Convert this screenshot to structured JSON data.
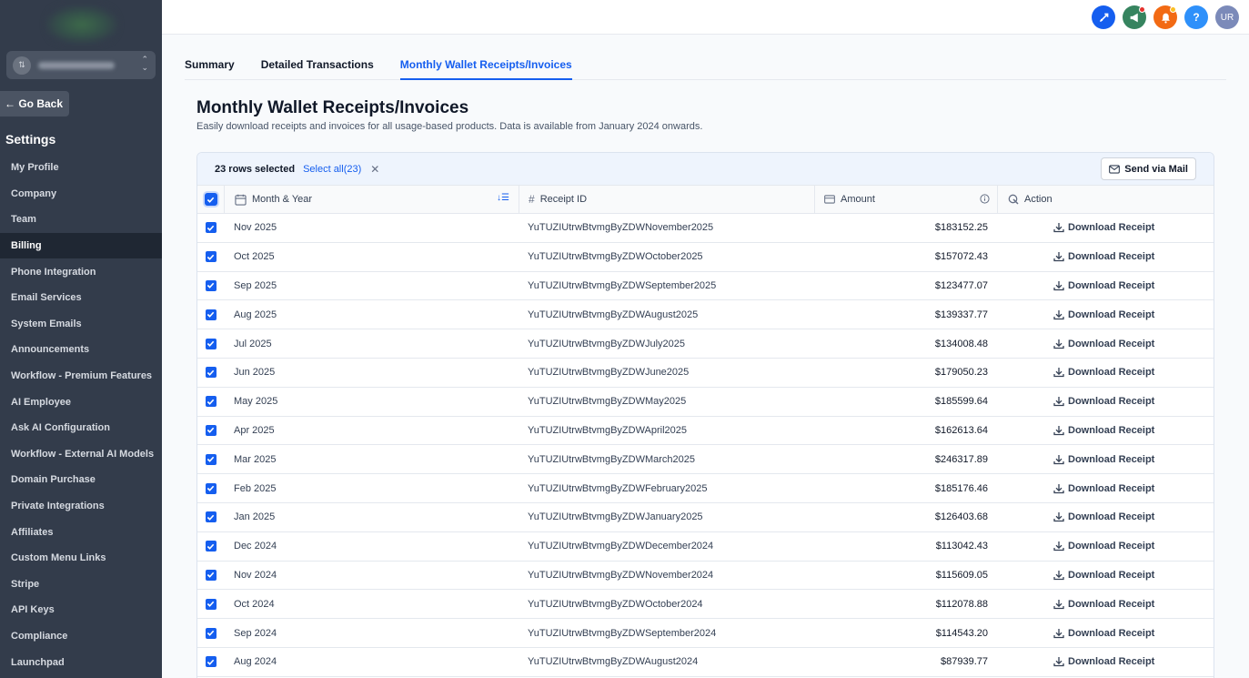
{
  "sidebar": {
    "back_label": "← Go Back",
    "title": "Settings",
    "items": [
      {
        "label": "My Profile",
        "active": false
      },
      {
        "label": "Company",
        "active": false
      },
      {
        "label": "Team",
        "active": false
      },
      {
        "label": "Billing",
        "active": true
      },
      {
        "label": "Phone Integration",
        "active": false
      },
      {
        "label": "Email Services",
        "active": false
      },
      {
        "label": "System Emails",
        "active": false
      },
      {
        "label": "Announcements",
        "active": false
      },
      {
        "label": "Workflow - Premium Features",
        "active": false
      },
      {
        "label": "AI Employee",
        "active": false
      },
      {
        "label": "Ask AI Configuration",
        "active": false
      },
      {
        "label": "Workflow - External AI Models",
        "active": false
      },
      {
        "label": "Domain Purchase",
        "active": false
      },
      {
        "label": "Private Integrations",
        "active": false
      },
      {
        "label": "Affiliates",
        "active": false
      },
      {
        "label": "Custom Menu Links",
        "active": false
      },
      {
        "label": "Stripe",
        "active": false
      },
      {
        "label": "API Keys",
        "active": false
      },
      {
        "label": "Compliance",
        "active": false
      },
      {
        "label": "Launchpad",
        "active": false
      }
    ]
  },
  "topbar": {
    "icons": [
      {
        "name": "quick-action-icon",
        "color": "#155eef"
      },
      {
        "name": "megaphone-icon",
        "color": "#36845f",
        "dot": true
      },
      {
        "name": "bell-icon",
        "color": "#f26a14",
        "dot": true
      },
      {
        "name": "help-icon",
        "color": "#2e90fa",
        "glyph": "?"
      }
    ],
    "avatar_initials": "UR"
  },
  "tabs": [
    {
      "label": "Summary",
      "active": false
    },
    {
      "label": "Detailed Transactions",
      "active": false
    },
    {
      "label": "Monthly Wallet Receipts/Invoices",
      "active": true
    }
  ],
  "page": {
    "title": "Monthly Wallet Receipts/Invoices",
    "subtitle": "Easily download receipts and invoices for all usage-based products. Data is available from January 2024 onwards."
  },
  "table": {
    "selection": {
      "count_text": "23 rows selected",
      "select_all_label": "Select all(23)"
    },
    "send_mail_label": "Send via Mail",
    "columns": {
      "month": "Month & Year",
      "receipt_id": "Receipt ID",
      "amount": "Amount",
      "action": "Action"
    },
    "action_label": "Download Receipt",
    "rows": [
      {
        "month": "Nov 2025",
        "receipt_id": "YuTUZIUtrwBtvmgByZDWNovember2025",
        "amount": "$183152.25",
        "checked": true
      },
      {
        "month": "Oct 2025",
        "receipt_id": "YuTUZIUtrwBtvmgByZDWOctober2025",
        "amount": "$157072.43",
        "checked": true
      },
      {
        "month": "Sep 2025",
        "receipt_id": "YuTUZIUtrwBtvmgByZDWSeptember2025",
        "amount": "$123477.07",
        "checked": true
      },
      {
        "month": "Aug 2025",
        "receipt_id": "YuTUZIUtrwBtvmgByZDWAugust2025",
        "amount": "$139337.77",
        "checked": true
      },
      {
        "month": "Jul 2025",
        "receipt_id": "YuTUZIUtrwBtvmgByZDWJuly2025",
        "amount": "$134008.48",
        "checked": true
      },
      {
        "month": "Jun 2025",
        "receipt_id": "YuTUZIUtrwBtvmgByZDWJune2025",
        "amount": "$179050.23",
        "checked": true
      },
      {
        "month": "May 2025",
        "receipt_id": "YuTUZIUtrwBtvmgByZDWMay2025",
        "amount": "$185599.64",
        "checked": true
      },
      {
        "month": "Apr 2025",
        "receipt_id": "YuTUZIUtrwBtvmgByZDWApril2025",
        "amount": "$162613.64",
        "checked": true
      },
      {
        "month": "Mar 2025",
        "receipt_id": "YuTUZIUtrwBtvmgByZDWMarch2025",
        "amount": "$246317.89",
        "checked": true
      },
      {
        "month": "Feb 2025",
        "receipt_id": "YuTUZIUtrwBtvmgByZDWFebruary2025",
        "amount": "$185176.46",
        "checked": true
      },
      {
        "month": "Jan 2025",
        "receipt_id": "YuTUZIUtrwBtvmgByZDWJanuary2025",
        "amount": "$126403.68",
        "checked": true
      },
      {
        "month": "Dec 2024",
        "receipt_id": "YuTUZIUtrwBtvmgByZDWDecember2024",
        "amount": "$113042.43",
        "checked": true
      },
      {
        "month": "Nov 2024",
        "receipt_id": "YuTUZIUtrwBtvmgByZDWNovember2024",
        "amount": "$115609.05",
        "checked": true
      },
      {
        "month": "Oct 2024",
        "receipt_id": "YuTUZIUtrwBtvmgByZDWOctober2024",
        "amount": "$112078.88",
        "checked": true
      },
      {
        "month": "Sep 2024",
        "receipt_id": "YuTUZIUtrwBtvmgByZDWSeptember2024",
        "amount": "$114543.20",
        "checked": true
      },
      {
        "month": "Aug 2024",
        "receipt_id": "YuTUZIUtrwBtvmgByZDWAugust2024",
        "amount": "$87939.77",
        "checked": true
      }
    ]
  },
  "colors": {
    "accent": "#155eef",
    "sidebar_bg": "#333c4b",
    "sidebar_active_bg": "#1f2733"
  }
}
